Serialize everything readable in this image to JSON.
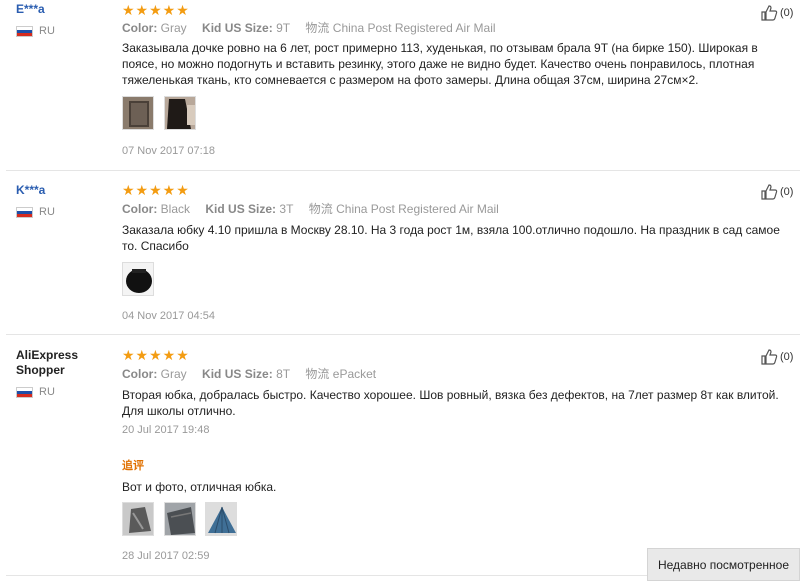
{
  "reviews": [
    {
      "user": "E***a",
      "country": "RU",
      "stars": "★★★★★",
      "color_label": "Color:",
      "color": "Gray",
      "size_label": "Kid US Size:",
      "size": "9T",
      "shipping_icon": "物流",
      "shipping": "China Post Registered Air Mail",
      "text": "Заказывала дочке ровно на 6 лет, рост примерно 113, худенькая, по отзывам брала 9Т (на бирке 150). Широкая в поясе, но можно подогнуть и вставить резинку, этого даже не видно будет. Качество очень понравилось, плотная тяжеленькая ткань, кто сомневается с размером на фото замеры. Длина общая 37см, ширина 27см×2.",
      "date": "07 Nov 2017 07:18",
      "likes": "(0)"
    },
    {
      "user": "K***a",
      "country": "RU",
      "stars": "★★★★★",
      "color_label": "Color:",
      "color": "Black",
      "size_label": "Kid US Size:",
      "size": "3T",
      "shipping_icon": "物流",
      "shipping": "China Post Registered Air Mail",
      "text": "Заказала юбку 4.10 пришла в Москву 28.10. На 3 года рост 1м, взяла 100.отлично подошло. На праздник в сад самое то. Спасибо",
      "date": "04 Nov 2017 04:54",
      "likes": "(0)"
    },
    {
      "user": "AliExpress Shopper",
      "country": "RU",
      "stars": "★★★★★",
      "color_label": "Color:",
      "color": "Gray",
      "size_label": "Kid US Size:",
      "size": "8T",
      "shipping_icon": "物流",
      "shipping": "ePacket",
      "text": "Вторая юбка, добралась быстро. Качество хорошее. Шов ровный, вязка без дефектов, на 7лет размер 8т как влитой. Для школы отлично.",
      "date": "20 Jul 2017 19:48",
      "additional_label": "追评",
      "additional_text": "Вот и фото, отличная юбка.",
      "additional_date": "28 Jul 2017 02:59",
      "likes": "(0)"
    }
  ],
  "recently_viewed": "Недавно посмотренное",
  "colors": {
    "star": "#f39c12",
    "username": "#2a5db0",
    "additional": "#e07000"
  }
}
